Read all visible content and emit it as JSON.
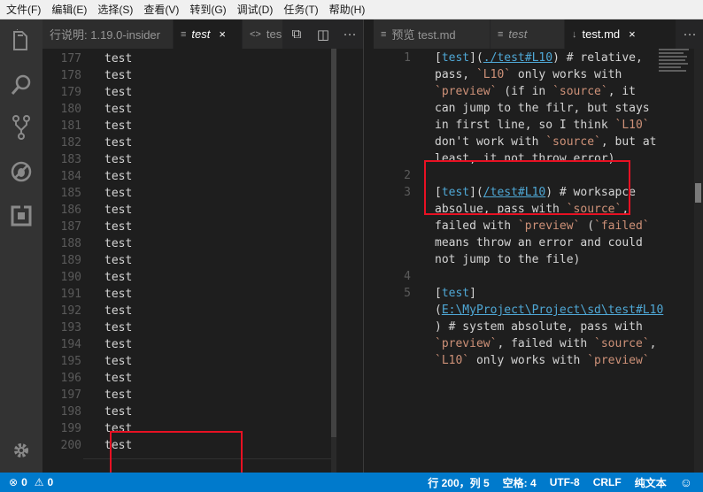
{
  "menu": [
    "文件(F)",
    "编辑(E)",
    "选择(S)",
    "查看(V)",
    "转到(G)",
    "调试(D)",
    "任务(T)",
    "帮助(H)"
  ],
  "activity": [
    {
      "icon": "files-icon"
    },
    {
      "icon": "search-icon"
    },
    {
      "icon": "source-control-icon"
    },
    {
      "icon": "debug-icon"
    },
    {
      "icon": "extensions-icon"
    },
    {
      "icon": "gear-icon"
    }
  ],
  "group1": {
    "tabs": [
      {
        "label": "行说明: 1.19.0-insider",
        "active": false,
        "icon": ""
      },
      {
        "label": "test",
        "active": true,
        "icon": "≡",
        "close": "×",
        "italic": true
      },
      {
        "label": "tes",
        "active": false,
        "icon": "<>"
      }
    ],
    "actions": [
      "⧉",
      "◫",
      "···"
    ],
    "lines": [
      {
        "n": "177",
        "text": "test"
      },
      {
        "n": "178",
        "text": "test"
      },
      {
        "n": "179",
        "text": "test"
      },
      {
        "n": "180",
        "text": "test"
      },
      {
        "n": "181",
        "text": "test"
      },
      {
        "n": "182",
        "text": "test"
      },
      {
        "n": "183",
        "text": "test"
      },
      {
        "n": "184",
        "text": "test"
      },
      {
        "n": "185",
        "text": "test"
      },
      {
        "n": "186",
        "text": "test"
      },
      {
        "n": "187",
        "text": "test"
      },
      {
        "n": "188",
        "text": "test"
      },
      {
        "n": "189",
        "text": "test"
      },
      {
        "n": "190",
        "text": "test"
      },
      {
        "n": "191",
        "text": "test"
      },
      {
        "n": "192",
        "text": "test"
      },
      {
        "n": "193",
        "text": "test"
      },
      {
        "n": "194",
        "text": "test"
      },
      {
        "n": "195",
        "text": "test"
      },
      {
        "n": "196",
        "text": "test"
      },
      {
        "n": "197",
        "text": "test"
      },
      {
        "n": "198",
        "text": "test"
      },
      {
        "n": "199",
        "text": "test"
      },
      {
        "n": "200",
        "text": "test"
      }
    ]
  },
  "group2": {
    "tabs": [
      {
        "label": "预览 test.md",
        "active": false,
        "icon": "≡"
      },
      {
        "label": "test",
        "active": false,
        "icon": "≡",
        "italic": true
      },
      {
        "label": "test.md",
        "active": true,
        "icon": "↓",
        "close": "×"
      }
    ],
    "actions": [
      "···"
    ],
    "lines": [
      {
        "n": "1",
        "segs": [
          [
            "p",
            "["
          ],
          [
            "link",
            "test"
          ],
          [
            "p",
            "]("
          ],
          [
            "url",
            "./test#L10"
          ],
          [
            "p",
            ") # relative,"
          ]
        ]
      },
      {
        "n": "",
        "segs": [
          [
            "p",
            "pass, "
          ],
          [
            "code",
            "`L10`"
          ],
          [
            "p",
            " only works with"
          ]
        ]
      },
      {
        "n": "",
        "segs": [
          [
            "code",
            "`preview`"
          ],
          [
            "p",
            " (if in "
          ],
          [
            "code",
            "`source`"
          ],
          [
            "p",
            ", it"
          ]
        ]
      },
      {
        "n": "",
        "segs": [
          [
            "p",
            "can jump to the filr, but stays"
          ]
        ]
      },
      {
        "n": "",
        "segs": [
          [
            "p",
            "in first line, so I think "
          ],
          [
            "code",
            "`L10`"
          ]
        ]
      },
      {
        "n": "",
        "segs": [
          [
            "p",
            "don't work with "
          ],
          [
            "code",
            "`source`"
          ],
          [
            "p",
            ", but at"
          ]
        ]
      },
      {
        "n": "",
        "segs": [
          [
            "p",
            "least, it not throw error)"
          ]
        ]
      },
      {
        "n": "2",
        "segs": []
      },
      {
        "n": "3",
        "segs": [
          [
            "p",
            "["
          ],
          [
            "link",
            "test"
          ],
          [
            "p",
            "]("
          ],
          [
            "url",
            "/test#L10"
          ],
          [
            "p",
            ") # worksapce"
          ]
        ]
      },
      {
        "n": "",
        "segs": [
          [
            "p",
            "absolue, pass with "
          ],
          [
            "code",
            "`source`"
          ],
          [
            "p",
            ","
          ]
        ]
      },
      {
        "n": "",
        "segs": [
          [
            "p",
            "failed with "
          ],
          [
            "code",
            "`preview`"
          ],
          [
            "p",
            " ("
          ],
          [
            "code",
            "`failed`"
          ]
        ]
      },
      {
        "n": "",
        "segs": [
          [
            "p",
            "means throw an error and could"
          ]
        ]
      },
      {
        "n": "",
        "segs": [
          [
            "p",
            "not jump to the file)"
          ]
        ]
      },
      {
        "n": "4",
        "segs": []
      },
      {
        "n": "5",
        "segs": [
          [
            "p",
            "["
          ],
          [
            "link",
            "test"
          ],
          [
            "p",
            "]"
          ]
        ]
      },
      {
        "n": "",
        "segs": [
          [
            "p",
            "("
          ],
          [
            "url",
            "E:\\MyProject\\Project\\sd\\test#L10"
          ]
        ]
      },
      {
        "n": "",
        "segs": [
          [
            "p",
            ") # system absolute, pass with"
          ]
        ]
      },
      {
        "n": "",
        "segs": [
          [
            "code",
            "`preview`"
          ],
          [
            "p",
            ", failed with "
          ],
          [
            "code",
            "`source`"
          ],
          [
            "p",
            ","
          ]
        ]
      },
      {
        "n": "",
        "segs": [
          [
            "code",
            "`L10`"
          ],
          [
            "p",
            " only works with "
          ],
          [
            "code",
            "`preview`"
          ]
        ]
      }
    ]
  },
  "status": {
    "errors": "0",
    "warnings": "0",
    "position": "行 200，列 5",
    "indent": "空格: 4",
    "encoding": "UTF-8",
    "eol": "CRLF",
    "language": "纯文本",
    "feedback_icon": "smiley-icon"
  },
  "colors": {
    "statusbar": "#007acc",
    "highlight_box": "#e81123",
    "link": "#4fa8d6",
    "inline_code": "#ce9178"
  }
}
